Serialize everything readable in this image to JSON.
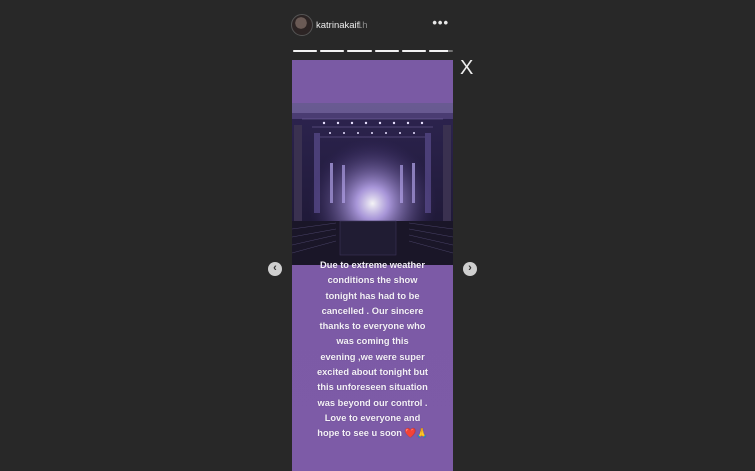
{
  "header": {
    "username": "katrinakaif",
    "time": "1h",
    "more_label": "•••"
  },
  "progress": [
    1,
    1,
    1,
    1,
    1,
    0.8
  ],
  "story": {
    "caption_lines": [
      "Due to extreme weather",
      "conditions the show",
      "tonight has had to be",
      "cancelled . Our sincere",
      "thanks to everyone who",
      "was coming this",
      "evening ,we were super",
      "excited about tonight but",
      "this unforeseen situation",
      "was beyond our control .",
      "Love to everyone and",
      "hope to see u soon"
    ],
    "emoji": "❤️🙏"
  },
  "controls": {
    "close_label": "X",
    "prev_label": "‹",
    "next_label": "›"
  },
  "colors": {
    "background": "#282828",
    "story_bg": "#7b5aa5"
  }
}
